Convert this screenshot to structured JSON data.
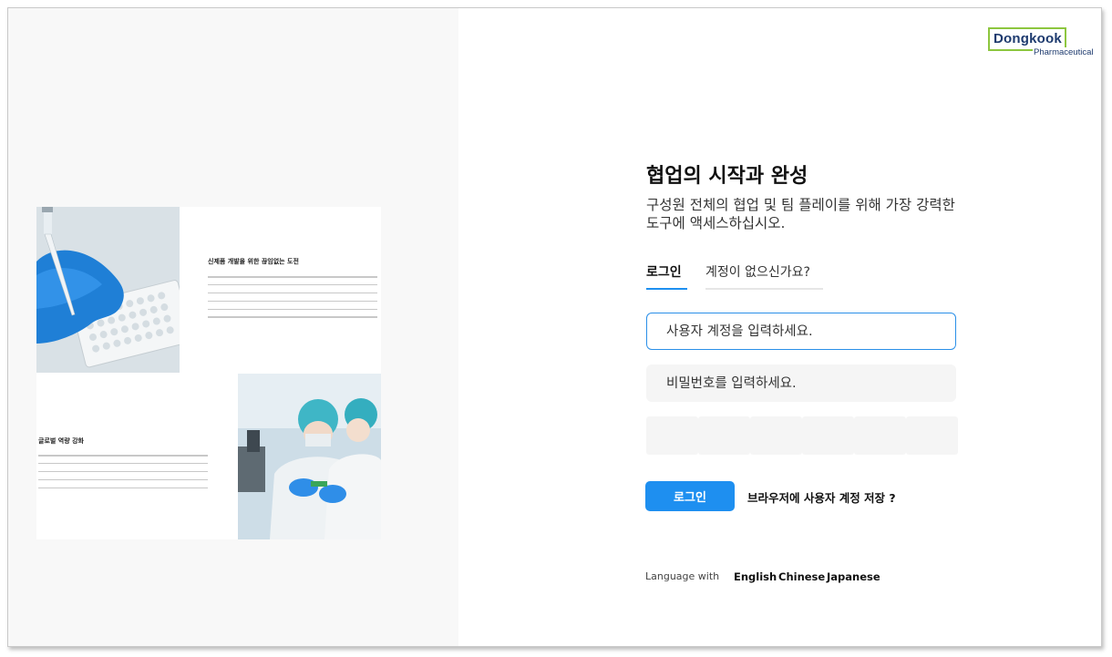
{
  "brand": {
    "logo_main": "Dongkook",
    "logo_sub": "Pharmaceutical",
    "accent_color": "#1e8ff0",
    "logo_green": "#8dc63f",
    "logo_navy": "#1d3a6e"
  },
  "brochure": {
    "section1_title": "신제품 개발을 위한 끊임없는 도전",
    "section2_title": "글로벌 역량 강화"
  },
  "login": {
    "heading": "협업의 시작과 완성",
    "subtitle": "구성원 전체의 협업 및 팀 플레이를 위해 가장 강력한 도구에 액세스하십시오.",
    "tabs": [
      {
        "label": "로그인",
        "active": true
      },
      {
        "label": "계정이 없으신가요?",
        "active": false
      }
    ],
    "username_placeholder": "사용자 계정을 입력하세요.",
    "password_placeholder": "비밀번호를 입력하세요.",
    "otp_count": 6,
    "login_button": "로그인",
    "save_account_label": "브라우저에 사용자 계정 저장 ?"
  },
  "language": {
    "label": "Language with",
    "options": [
      "English",
      "Chinese",
      "Japanese"
    ]
  }
}
